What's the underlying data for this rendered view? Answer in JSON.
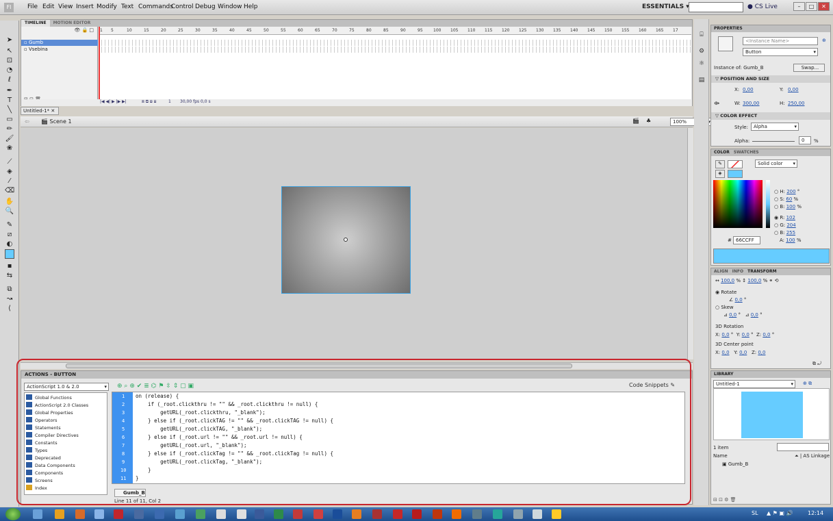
{
  "menu": {
    "logo": "Fl",
    "items": [
      "File",
      "Edit",
      "View",
      "Insert",
      "Modify",
      "Text",
      "Commands",
      "Control",
      "Debug",
      "Window",
      "Help"
    ]
  },
  "workspace": "ESSENTIALS ▾",
  "cslive": "CS Live",
  "timeline": {
    "tab_timeline": "TIMELINE",
    "tab_motion": "MOTION EDITOR",
    "layers": [
      "Gumb",
      "Vsebina"
    ],
    "ruler": [
      "1",
      "5",
      "10",
      "15",
      "20",
      "25",
      "30",
      "35",
      "40",
      "45",
      "50",
      "55",
      "60",
      "65",
      "70",
      "75",
      "80",
      "85",
      "90",
      "95",
      "100",
      "105",
      "110",
      "115",
      "120",
      "125",
      "130",
      "135",
      "140",
      "145",
      "150",
      "155",
      "160",
      "165",
      "17"
    ],
    "frame": "1",
    "fps": "30,00 fps",
    "time": "0,0 s"
  },
  "document": {
    "tab": "Untitled-1*",
    "scene": "Scene 1",
    "zoom": "100%"
  },
  "actions": {
    "header": "ACTIONS - BUTTON",
    "as_version": "ActionScript 1.0 & 2.0",
    "code_snippets": "Code Snippets",
    "tree": [
      "Global Functions",
      "ActionScript 2.0 Classes",
      "Global Properties",
      "Operators",
      "Statements",
      "Compiler Directives",
      "Constants",
      "Types",
      "Deprecated",
      "Data Components",
      "Components",
      "Screens",
      "Index"
    ],
    "code": [
      "on (release) {",
      "    if (_root.clickthru != \"\" && _root.clickthru != null) {",
      "        getURL(_root.clickthru, \"_blank\");",
      "    } else if (_root.clickTAG != \"\" && _root.clickTAG != null) {",
      "        getURL(_root.clickTAG, \"_blank\");",
      "    } else if (_root.url != \"\" && _root.url != null) {",
      "        getURL(_root.url, \"_blank\");",
      "    } else if (_root.clickTag != \"\" && _root.clickTag != null) {",
      "        getURL(_root.clickTag, \"_blank\");",
      "    }",
      "}"
    ],
    "file_tab": "Gumb_B",
    "status": "Line 11 of 11, Col 2"
  },
  "properties": {
    "header": "PROPERTIES",
    "instance_name_placeholder": "<Instance Name>",
    "type": "Button",
    "instance_of_label": "Instance of:",
    "instance_of": "Gumb_B",
    "swap": "Swap...",
    "pos_size": "POSITION AND SIZE",
    "x_label": "X:",
    "x": "0,00",
    "y_label": "Y:",
    "y": "0,00",
    "w_label": "W:",
    "w": "300,00",
    "h_label": "H:",
    "h": "250,00",
    "color_effect": "COLOR EFFECT",
    "style_label": "Style:",
    "style": "Alpha",
    "alpha_label": "Alpha:",
    "alpha": "0",
    "alpha_unit": "%"
  },
  "color": {
    "tab_color": "COLOR",
    "tab_swatches": "SWATCHES",
    "fill_type": "Solid color",
    "h": "200",
    "s": "60",
    "b": "100",
    "r": "102",
    "g": "204",
    "bl": "255",
    "hex": "66CCFF",
    "a": "100",
    "swatch": "#66ccff"
  },
  "transform": {
    "tab_align": "ALIGN",
    "tab_info": "INFO",
    "tab_transform": "TRANSFORM",
    "scale_w": "100,0",
    "scale_h": "100,0",
    "rotate": "Rotate",
    "rotate_val": "0,0",
    "skew": "Skew",
    "skew_a": "0,0",
    "skew_b": "0,0",
    "rot3d": "3D Rotation",
    "rx": "0,0",
    "ry": "0,0",
    "rz": "0,0",
    "center3d": "3D Center point",
    "cx": "0,0",
    "cy": "0,0",
    "cz": "0,0"
  },
  "library": {
    "header": "LIBRARY",
    "doc": "Untitled-1",
    "count": "1 item",
    "col_name": "Name",
    "col_linkage": "AS Linkage",
    "item": "Gumb_B"
  },
  "taskbar": {
    "lang": "SL",
    "clock": "12:14"
  }
}
